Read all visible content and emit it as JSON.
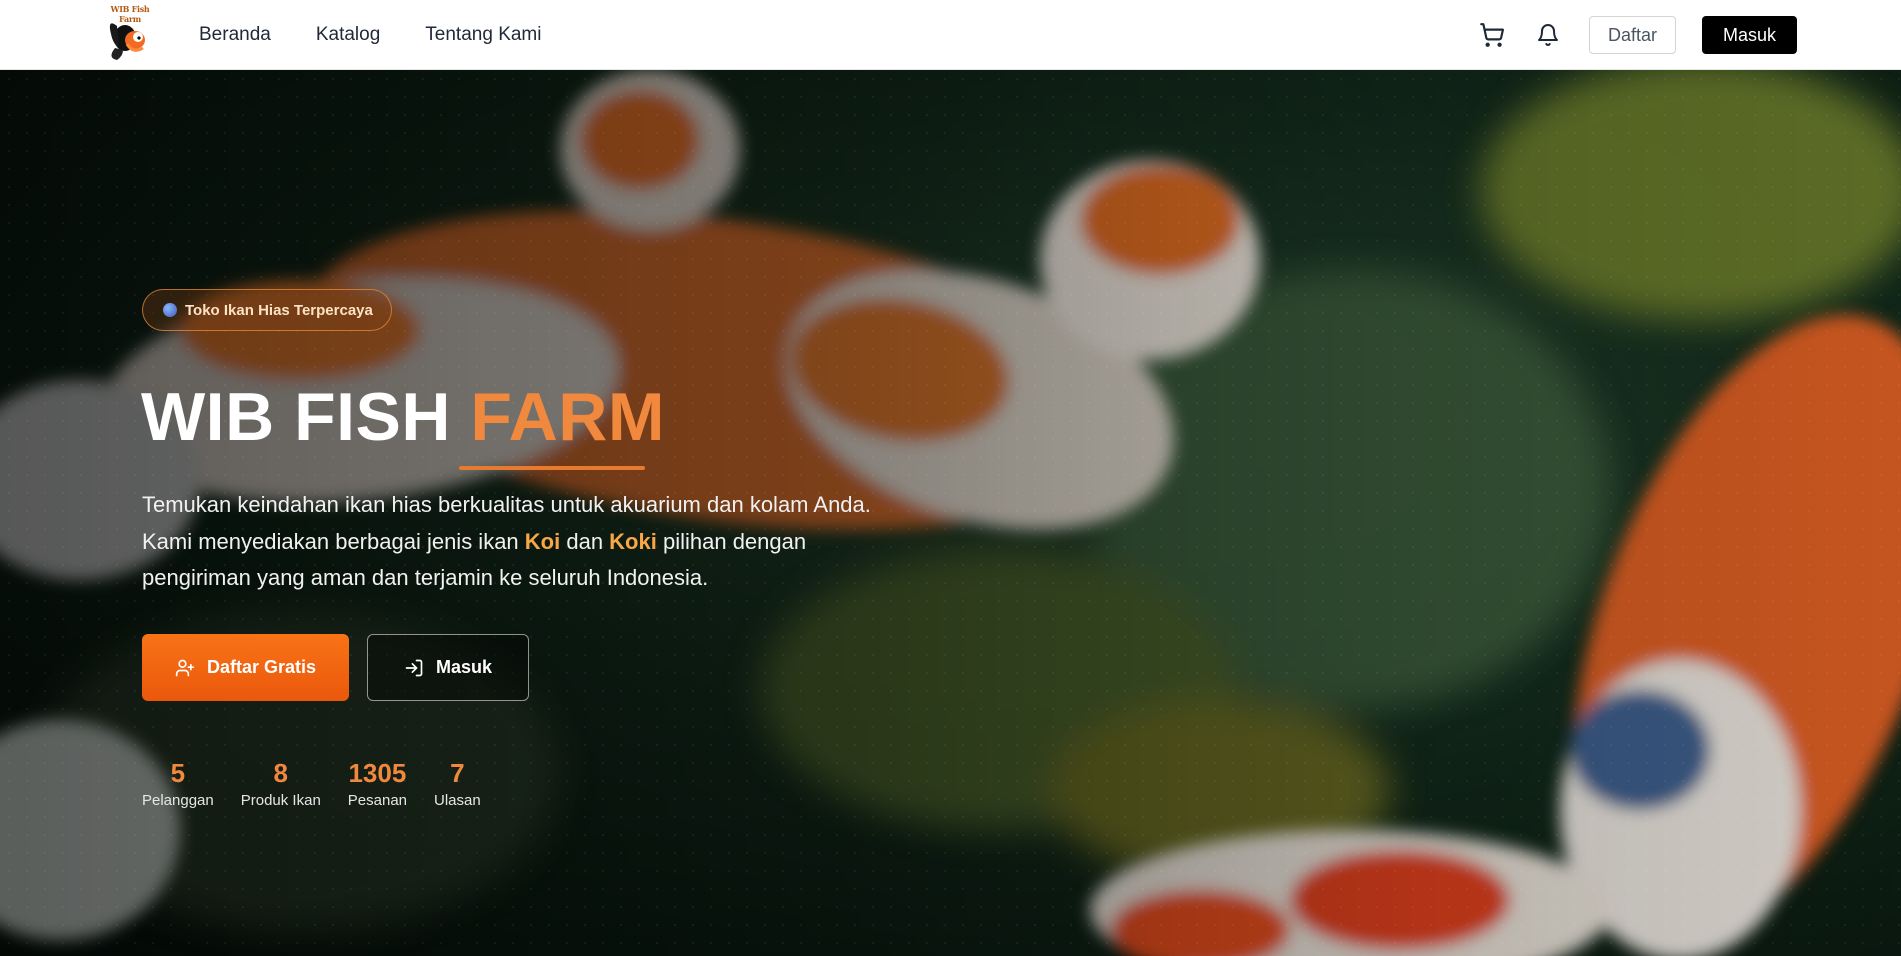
{
  "brand": {
    "logo_text": "WIB Fish Farm"
  },
  "nav": {
    "links": [
      "Beranda",
      "Katalog",
      "Tentang Kami"
    ],
    "register_label": "Daftar",
    "login_label": "Masuk"
  },
  "hero": {
    "badge": "Toko Ikan Hias Terpercaya",
    "title_main": "WIB FISH",
    "title_accent": "FARM",
    "desc_1": "Temukan keindahan ikan hias berkualitas untuk akuarium dan kolam Anda. Kami menyediakan berbagai jenis ikan ",
    "desc_koi": "Koi",
    "desc_2": " dan ",
    "desc_koki": "Koki",
    "desc_3": " pilihan dengan pengiriman yang aman dan terjamin ke seluruh Indonesia.",
    "cta_primary": "Daftar Gratis",
    "cta_secondary": "Masuk"
  },
  "stats": [
    {
      "value": "5",
      "label": "Pelanggan"
    },
    {
      "value": "8",
      "label": "Produk Ikan"
    },
    {
      "value": "1305",
      "label": "Pesanan"
    },
    {
      "value": "7",
      "label": "Ulasan"
    }
  ],
  "colors": {
    "accent": "#f0883e",
    "cta": "#f97316",
    "nav_bg": "#ffffff"
  }
}
